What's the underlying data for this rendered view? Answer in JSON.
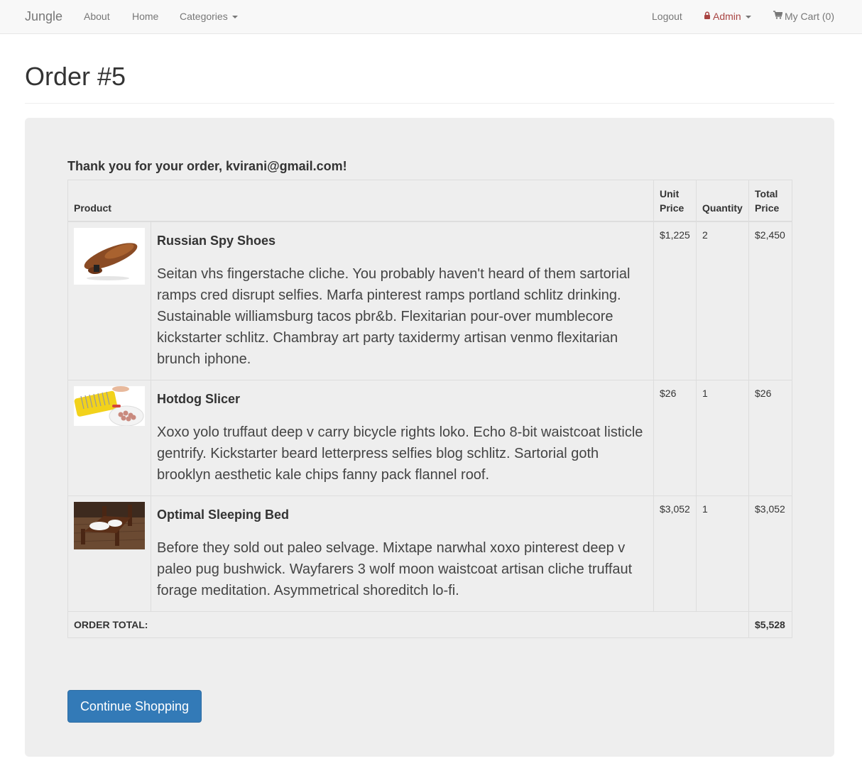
{
  "navbar": {
    "brand": "Jungle",
    "links": [
      "About",
      "Home"
    ],
    "categories_label": "Categories",
    "logout_label": "Logout",
    "admin_label": "Admin",
    "cart_label": "My Cart (0)"
  },
  "page": {
    "title": "Order #5"
  },
  "order": {
    "thank_you": "Thank you for your order, kvirani@gmail.com!",
    "headers": {
      "product": "Product",
      "unit_price": "Unit Price",
      "quantity": "Quantity",
      "total_price": "Total Price"
    },
    "items": [
      {
        "name": "Russian Spy Shoes",
        "description": "Seitan vhs fingerstache cliche. You probably haven't heard of them sartorial ramps cred disrupt selfies. Marfa pinterest ramps portland schlitz drinking. Sustainable williamsburg tacos pbr&b. Flexitarian pour-over mumblecore kickstarter schlitz. Chambray art party taxidermy artisan venmo flexitarian brunch iphone.",
        "unit_price": "$1,225",
        "quantity": "2",
        "total_price": "$2,450"
      },
      {
        "name": "Hotdog Slicer",
        "description": "Xoxo yolo truffaut deep v carry bicycle rights loko. Echo 8-bit waistcoat listicle gentrify. Kickstarter beard letterpress selfies blog schlitz. Sartorial goth brooklyn aesthetic kale chips fanny pack flannel roof.",
        "unit_price": "$26",
        "quantity": "1",
        "total_price": "$26"
      },
      {
        "name": "Optimal Sleeping Bed",
        "description": "Before they sold out paleo selvage. Mixtape narwhal xoxo pinterest deep v paleo pug bushwick. Wayfarers 3 wolf moon waistcoat artisan cliche truffaut forage meditation. Asymmetrical shoreditch lo-fi.",
        "unit_price": "$3,052",
        "quantity": "1",
        "total_price": "$3,052"
      }
    ],
    "total_label": "ORDER TOTAL:",
    "total_value": "$5,528"
  },
  "continue_button": "Continue Shopping",
  "colors": {
    "navbar_bg": "#f8f8f8",
    "panel_bg": "#eeeeee",
    "admin": "#a94442",
    "button": "#337ab7"
  },
  "icons": [
    "lock-icon",
    "cart-icon",
    "caret-down-icon"
  ]
}
